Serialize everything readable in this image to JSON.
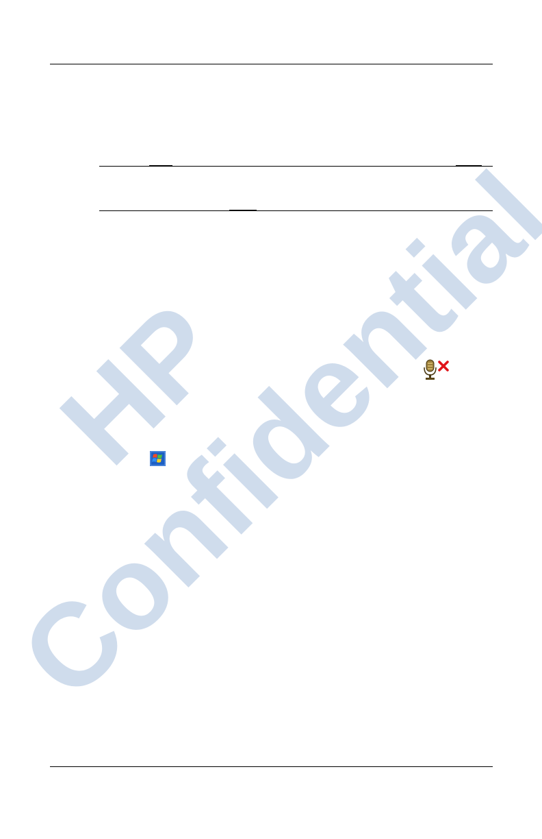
{
  "watermark": {
    "line1": "HP",
    "line2": "Confidential",
    "color": "#cfdcec"
  },
  "icons": {
    "mic": "microphone-disabled-icon",
    "start": "windows-start-icon"
  }
}
